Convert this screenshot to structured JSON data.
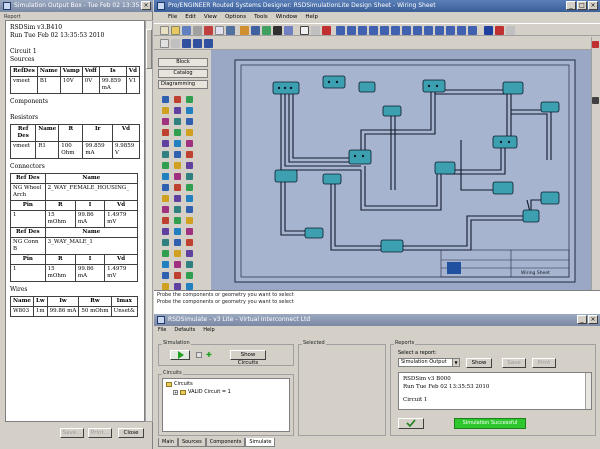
{
  "report_window": {
    "title": "Simulation Output Box - Tue Feb 02 13:35:53",
    "group_label": "Report",
    "lines": {
      "header1": "RSDSim v3.B410",
      "header2": "Run Tue Feb 02 13:35:53 2010",
      "circuit": "Circuit 1",
      "sources_label": "Sources",
      "components_label": "Components",
      "resistors_label": "Resistors",
      "connectors_label": "Connectors",
      "wires_label": "Wires"
    },
    "sources_table": {
      "headers": [
        "RefDes",
        "Name",
        "Vamp",
        "Voff",
        "Is",
        "Vd"
      ],
      "rows": [
        [
          "vmeet",
          "B1",
          "10V",
          "0V",
          "99.859 mA",
          "V1"
        ]
      ]
    },
    "resistors_table": {
      "headers": [
        "Ref Des",
        "Name",
        "R",
        "Ir",
        "Vd"
      ],
      "rows": [
        [
          "vmeet",
          "R1",
          "100 Ohm",
          "99.859 mA",
          "9.9859 V"
        ]
      ]
    },
    "connector1": {
      "headers": [
        "Ref Des",
        "Name"
      ],
      "refdes": "NG Wheel Arch",
      "name": "2_WAY_FEMALE_HOUSING_",
      "pin_headers": [
        "Pin",
        "R",
        "I",
        "Vd"
      ],
      "pin_row": [
        "1",
        "15 mOhm",
        "99.86 mA",
        "1.4979 mV"
      ]
    },
    "connector2": {
      "headers": [
        "Ref Des",
        "Name"
      ],
      "refdes": "NG Conn B",
      "name": "3_WAY_MALE_1",
      "pin_headers": [
        "Pin",
        "R",
        "I",
        "Vd"
      ],
      "pin_row": [
        "1",
        "15 mOhm",
        "99.86 mA",
        "1.4979 mV"
      ]
    },
    "wires_table": {
      "headers": [
        "Name",
        "Lw",
        "Iw",
        "Rw",
        "Imax"
      ],
      "rows": [
        [
          "W803",
          "1m",
          "99.86 mA",
          "50 mOhm",
          "Unset&"
        ]
      ]
    },
    "buttons": {
      "save": "Save...",
      "print": "Print...",
      "close": "Close"
    }
  },
  "main_window": {
    "title": "Pro/ENGINEER Routed Systems Designer: RSDSimulationLite Design Sheet - Wiring Sheet",
    "menu": [
      "File",
      "Edit",
      "View",
      "Options",
      "Tools",
      "Window",
      "Help"
    ],
    "panel_buttons": [
      "Block",
      "Catalog",
      "Diagramming"
    ],
    "drawing_title_block": "Wiring Sheet",
    "status_lines": [
      "Probe the components or geometry you want to select",
      "Probe the components or geometry you want to select"
    ]
  },
  "sim_window": {
    "title": "RSDSimulate - v3 Lite - Virtual Interconnect Ltd",
    "menu": [
      "File",
      "Defaults",
      "Help"
    ],
    "simulation_label": "Simulation",
    "show_circuits": "Show Circuits",
    "circuits_label": "Circuits",
    "circuits_tree": [
      "Circuits",
      "VALID Circuit = 1"
    ],
    "selected_label": "Selected",
    "reports_label": "Reports",
    "select_report_label": "Select a report:",
    "report_select_value": "Simulation Output",
    "show_button": "Show",
    "save_button": "Save",
    "print_button": "Print",
    "report_text": [
      "RSDSim v3 B000",
      "Run Tue Feb 02 13:35:53 2010",
      "",
      "Circuit 1"
    ],
    "status_message": "Simulation Successful",
    "status_color": "#2ec82e",
    "tabs": [
      "Main",
      "Sources",
      "Components",
      "Simulate"
    ]
  }
}
